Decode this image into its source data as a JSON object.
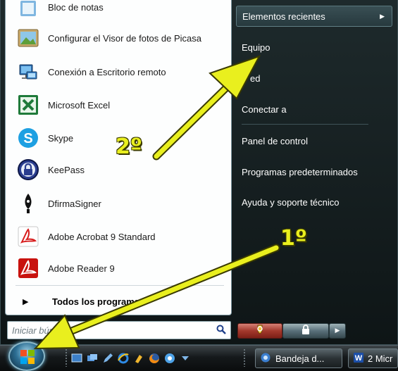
{
  "start_menu": {
    "programs": [
      {
        "label": "Bloc de notas",
        "icon": "notepad-icon"
      },
      {
        "label": "Configurar el Visor de fotos de Picasa",
        "icon": "picasa-icon"
      },
      {
        "label": "Conexión a Escritorio remoto",
        "icon": "remote-desktop-icon"
      },
      {
        "label": "Microsoft Excel",
        "icon": "excel-icon"
      },
      {
        "label": "Skype",
        "icon": "skype-icon"
      },
      {
        "label": "KeePass",
        "icon": "keepass-icon"
      },
      {
        "label": "DfirmaSigner",
        "icon": "pen-nib-icon"
      },
      {
        "label": "Adobe Acrobat 9 Standard",
        "icon": "acrobat-icon"
      },
      {
        "label": "Adobe Reader 9",
        "icon": "adobe-reader-icon"
      }
    ],
    "all_programs_label": "Todos los programas",
    "search": {
      "placeholder": "Iniciar búsqu"
    },
    "right_items": [
      {
        "label": "Elementos recientes",
        "has_submenu": true
      },
      {
        "label": "Equipo"
      },
      {
        "label": "ed"
      },
      {
        "label": "Conectar a"
      },
      {
        "label": "Panel de control"
      },
      {
        "label": "Programas predeterminados"
      },
      {
        "label": "Ayuda y soporte técnico"
      }
    ]
  },
  "taskbar": {
    "buttons": [
      {
        "label": "Bandeja d...",
        "icon": "outlook-icon"
      },
      {
        "label": "2 Micr",
        "icon": "word-icon"
      }
    ]
  },
  "annotations": {
    "step1": "1º",
    "step2": "2º",
    "arrow_color": "#e9ef1e"
  }
}
